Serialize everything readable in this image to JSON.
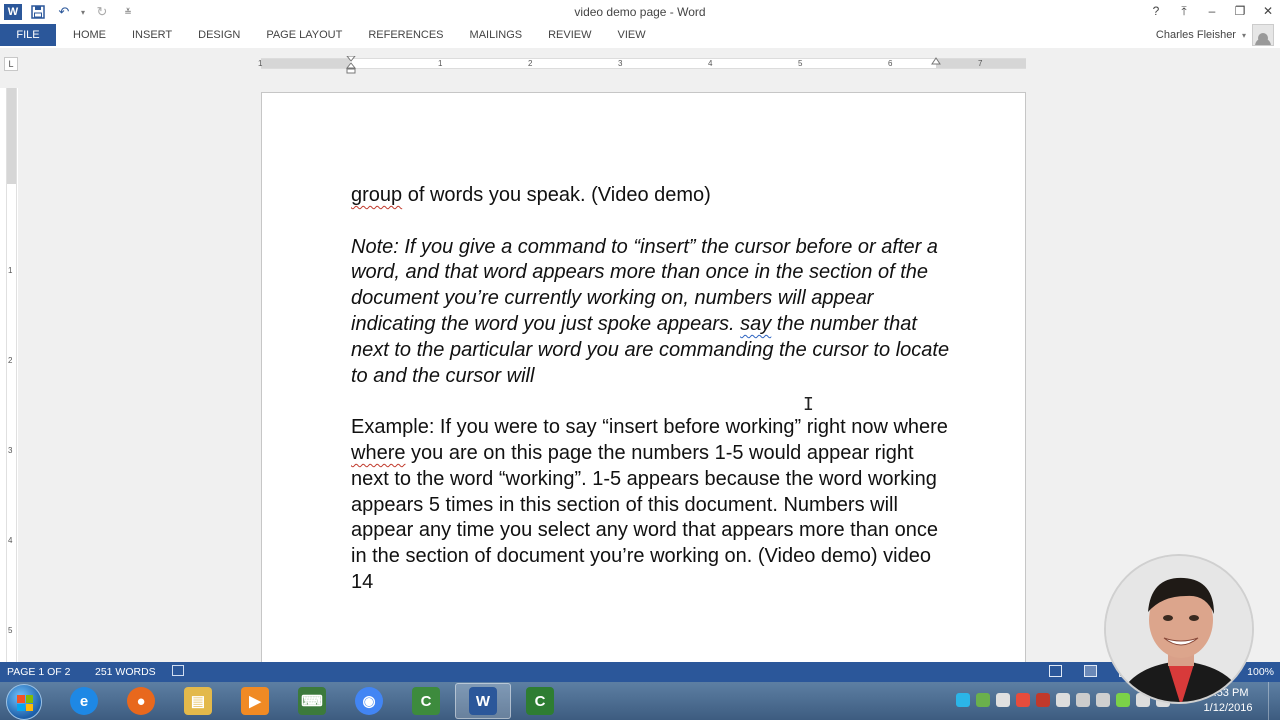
{
  "window": {
    "title": "video demo page - Word",
    "controls": [
      "?",
      "⤒",
      "–",
      "❐",
      "✕"
    ]
  },
  "ribbon": {
    "file_label": "FILE",
    "tabs": [
      "HOME",
      "INSERT",
      "DESIGN",
      "PAGE LAYOUT",
      "REFERENCES",
      "MAILINGS",
      "REVIEW",
      "VIEW"
    ],
    "user_name": "Charles Fleisher"
  },
  "ruler": {
    "tab_selector": "L",
    "numbers": [
      "1",
      "1",
      "2",
      "3",
      "4",
      "5",
      "6",
      "7"
    ],
    "vertical_numbers": [
      "1",
      "2",
      "3",
      "4",
      "5"
    ]
  },
  "document": {
    "line0_sq": "group",
    "line0_rest": " of words you speak. (Video demo)",
    "note_before": "Note: If you give a command to “insert” the cursor before or after a word, and that word appears more than once in the section of the document you’re currently working on, numbers will appear indicating the word you just spoke appears. ",
    "note_sq": "say",
    "note_after": " the number that next to the particular word you are commanding the cursor to locate to and the cursor will",
    "example_before": "Example: If you were to say “insert before working” right now where ",
    "example_sq": "where",
    "example_after": " you are on this page the numbers 1-5 would appear right next to the word “working”. 1-5 appears because the word working appears 5 times in this section of this document. Numbers will appear any time you select any word that appears more than once in the section of document you’re working on. (Video demo) video 14"
  },
  "status": {
    "page": "PAGE 1 OF 2",
    "words": "251 WORDS",
    "zoom": "100%"
  },
  "taskbar": {
    "apps": [
      {
        "name": "internet-explorer",
        "color": "#1e88e5",
        "glyph": "e"
      },
      {
        "name": "firefox",
        "color": "#e8681d",
        "glyph": "●"
      },
      {
        "name": "file-explorer",
        "color": "#e3b94b",
        "glyph": "▤"
      },
      {
        "name": "media-player",
        "color": "#f08a24",
        "glyph": "▶"
      },
      {
        "name": "terminal-app",
        "color": "#3c7a3c",
        "glyph": "⌨"
      },
      {
        "name": "chrome",
        "color": "#4285f4",
        "glyph": "◉"
      },
      {
        "name": "camtasia-recorder",
        "color": "#3d8b3d",
        "glyph": "C"
      },
      {
        "name": "word",
        "color": "#2b579a",
        "glyph": "W"
      },
      {
        "name": "camtasia-studio",
        "color": "#2e7d32",
        "glyph": "C"
      }
    ],
    "active_app": "word",
    "tray_colors": [
      "#2bb5e8",
      "#6ab04c",
      "#e0e0e0",
      "#e74c3c",
      "#c0392b",
      "#dddddd",
      "#cccccc",
      "#cfcfcf",
      "#7bd148",
      "#dddddd",
      "#dddddd"
    ],
    "time": "8:53 PM",
    "date": "1/12/2016"
  }
}
